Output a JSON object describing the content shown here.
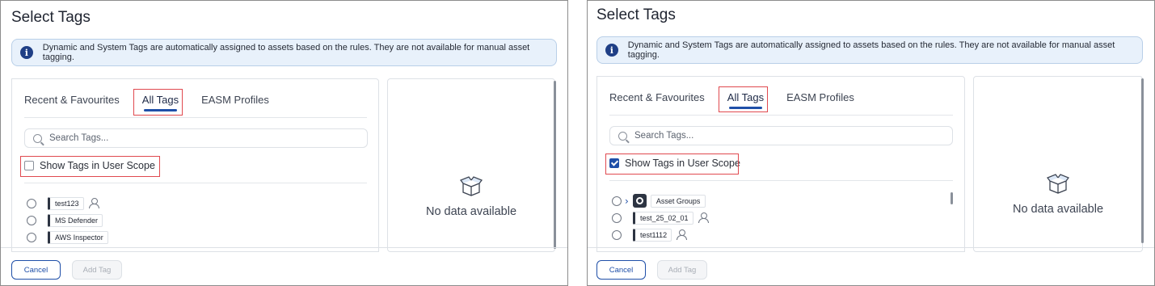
{
  "colors": {
    "accent": "#1f4fa8",
    "highlight": "#e0494f",
    "info_bg": "#e8f1fb"
  },
  "panels": [
    {
      "title": "Select Tags",
      "info_text": "Dynamic and System Tags are automatically assigned to assets based on the rules. They are not available for manual asset tagging.",
      "tabs": [
        "Recent & Favourites",
        "All Tags",
        "EASM Profiles"
      ],
      "active_tab": "All Tags",
      "search_placeholder": "Search Tags...",
      "scope_label": "Show Tags in User Scope",
      "scope_checked": false,
      "tags": [
        {
          "label": "test123",
          "icon": "user-icon"
        },
        {
          "label": "MS Defender"
        },
        {
          "label": "AWS Inspector"
        }
      ],
      "empty_text": "No data available",
      "cancel_label": "Cancel",
      "add_label": "Add Tag"
    },
    {
      "title": "Select Tags",
      "info_text": "Dynamic and System Tags are automatically assigned to assets based on the rules. They are not available for manual asset tagging.",
      "tabs": [
        "Recent & Favourites",
        "All Tags",
        "EASM Profiles"
      ],
      "active_tab": "All Tags",
      "search_placeholder": "Search Tags...",
      "scope_label": "Show Tags in User Scope",
      "scope_checked": true,
      "group_label": "Asset Groups",
      "tags": [
        {
          "label": "test_25_02_01",
          "icon": "user-icon"
        },
        {
          "label": "test1112",
          "icon": "user-icon"
        }
      ],
      "empty_text": "No data available",
      "cancel_label": "Cancel",
      "add_label": "Add Tag"
    }
  ]
}
